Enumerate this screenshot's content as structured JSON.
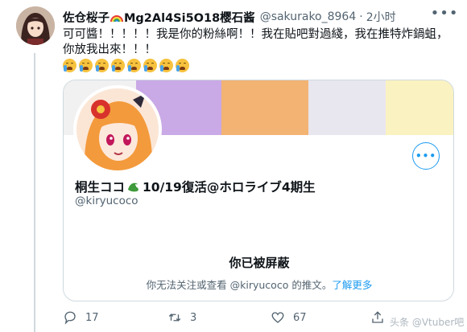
{
  "tweet": {
    "author_name": "佐仓桜子",
    "author_name_suffix": "Mg2Al4Si5O18樱石酱",
    "handle": "@sakurako_8964",
    "separator": "·",
    "time": "2小时",
    "text": "可可醬！！！！！我是你的粉絲啊！！我在貼吧對過綫，我在推特炸鍋蛆，你放我出來！！！",
    "emoji_count": 8,
    "emoji": "loudly-crying-face"
  },
  "card": {
    "banner_colors": [
      "#f1f1f1",
      "#c9a9e6",
      "#f2b373",
      "#e8e6ef",
      "#fbf2c2"
    ],
    "profile_name_prefix": "桐生ココ",
    "profile_name_suffix": "10/19復活@ホロライブ4期生",
    "profile_handle": "@kiryucoco",
    "more_label": "•••",
    "blocked_title": "你已被屏蔽",
    "blocked_desc": "你无法关注或查看 @kiryucoco 的推文。",
    "learn_more": "了解更多"
  },
  "actions": {
    "reply_count": "17",
    "retweet_count": "3",
    "like_count": "67"
  },
  "header": {
    "more_label": "•••"
  },
  "watermark": "头条 @Vtuber吧"
}
